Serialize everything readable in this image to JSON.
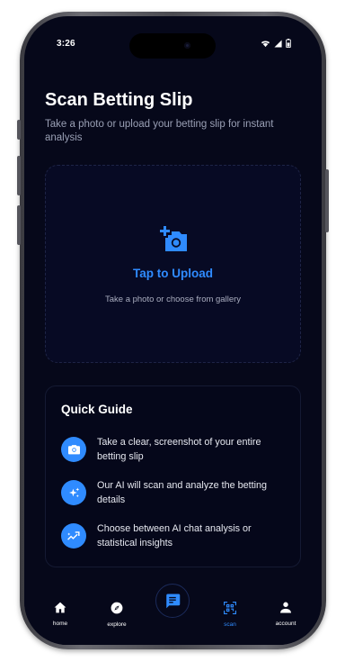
{
  "status_bar": {
    "time": "3:26"
  },
  "header": {
    "title": "Scan Betting Slip",
    "subtitle": "Take a photo or upload your betting slip for instant analysis"
  },
  "upload": {
    "title": "Tap to Upload",
    "subtitle": "Take a photo or choose from gallery",
    "icon": "add-a-photo-icon"
  },
  "guide": {
    "title": "Quick Guide",
    "items": [
      {
        "icon": "camera-icon",
        "text": "Take a clear, screenshot of your entire betting slip"
      },
      {
        "icon": "sparkle-icon",
        "text": "Our AI will scan and analyze the betting details"
      },
      {
        "icon": "trending-icon",
        "text": "Choose between AI chat analysis or statistical insights"
      }
    ]
  },
  "nav": {
    "items": [
      {
        "label": "home",
        "icon": "home-icon"
      },
      {
        "label": "explore",
        "icon": "compass-icon"
      },
      {
        "label": "",
        "icon": "chat-icon"
      },
      {
        "label": "scan",
        "icon": "qr-scan-icon",
        "active": true
      },
      {
        "label": "account",
        "icon": "person-icon"
      }
    ]
  },
  "colors": {
    "accent": "#2f8bff",
    "background": "#06081a"
  }
}
